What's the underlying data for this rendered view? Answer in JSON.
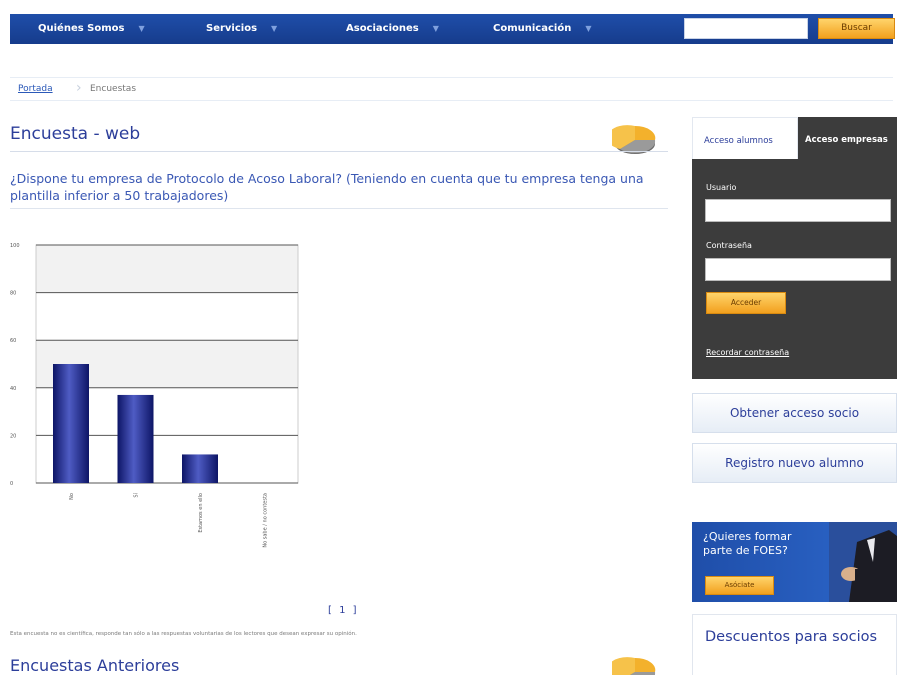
{
  "nav": {
    "items": [
      "Quiénes Somos",
      "Servicios",
      "Asociaciones",
      "Comunicación"
    ],
    "search_value": "",
    "search_button": "Buscar"
  },
  "breadcrumb": {
    "home": "Portada",
    "current": "Encuestas"
  },
  "main": {
    "title": "Encuesta - web",
    "question": "¿Dispone tu empresa de Protocolo de Acoso Laboral? (Teniendo en cuenta que tu empresa tenga una plantilla inferior a 50 trabajadores)",
    "pager": "[ 1 ]",
    "disclaimer": "Esta encuesta no es científica, responde tan sólo a las respuestas voluntarias de los lectores que desean expresar su opinión.",
    "previous_title": "Encuestas Anteriores"
  },
  "chart_data": {
    "type": "bar",
    "categories": [
      "No",
      "Sí",
      "Estamos en ello",
      "No sabe / no contesta"
    ],
    "values": [
      50,
      37,
      12,
      0
    ],
    "ylim": [
      0,
      100
    ],
    "yticks": [
      "0",
      "20",
      "40",
      "60",
      "80",
      "100"
    ],
    "grid": true,
    "bar_color": "#1f2a8c",
    "title": "",
    "xlabel": "",
    "ylabel": ""
  },
  "sidebar": {
    "tabs": [
      "Acceso alumnos",
      "Acceso empresas"
    ],
    "usuario_label": "Usuario",
    "usuario_value": "",
    "password_label": "Contraseña",
    "password_value": "",
    "acceder": "Acceder",
    "recordar": "Recordar contraseña",
    "obtener": "Obtener acceso socio",
    "registro": "Registro nuevo alumno",
    "promo_text": "¿Quieres formar parte de FOES?",
    "promo_button": "Asóciate",
    "descuentos": "Descuentos para socios"
  },
  "colors": {
    "nav": "#1f4ea9",
    "accent_orange": "#f2a01e",
    "link_blue": "#2c3e9a",
    "login_bg": "#3c3c3c"
  }
}
